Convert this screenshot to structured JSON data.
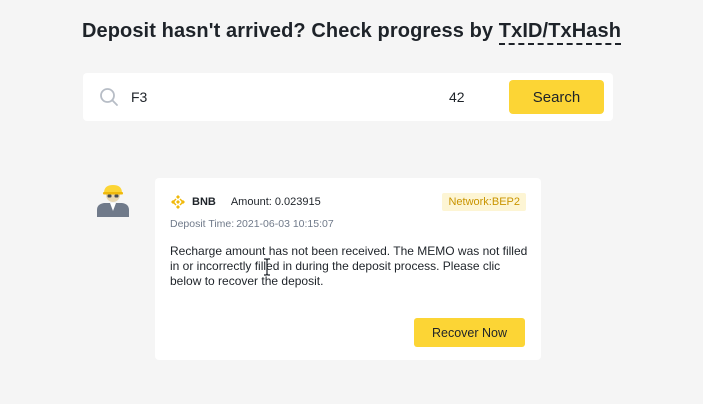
{
  "header": {
    "title_prefix": "Deposit hasn't arrived? Check progress by ",
    "title_link": "TxID/TxHash"
  },
  "search": {
    "value": "F3",
    "suffix": "42",
    "button_label": "Search",
    "icon": "search-icon"
  },
  "result": {
    "avatar_icon": "worker-avatar-icon",
    "coin_icon": "bnb-icon",
    "coin": "BNB",
    "amount_label": "Amount:",
    "amount_value": "0.023915",
    "network_label": "Network:",
    "network_value": "BEP2",
    "deposit_time_label": "Deposit Time:",
    "deposit_time_value": "2021-06-03 10:15:07",
    "message": "Recharge amount has not been received. The MEMO was not filled in or incorrectly filled in during the deposit process. Please clic below to recover the deposit.",
    "recover_button": "Recover Now"
  },
  "colors": {
    "accent": "#fcd535",
    "badge_bg": "#fdf5d4",
    "badge_text": "#c99400",
    "page_bg": "#f5f5f5"
  }
}
